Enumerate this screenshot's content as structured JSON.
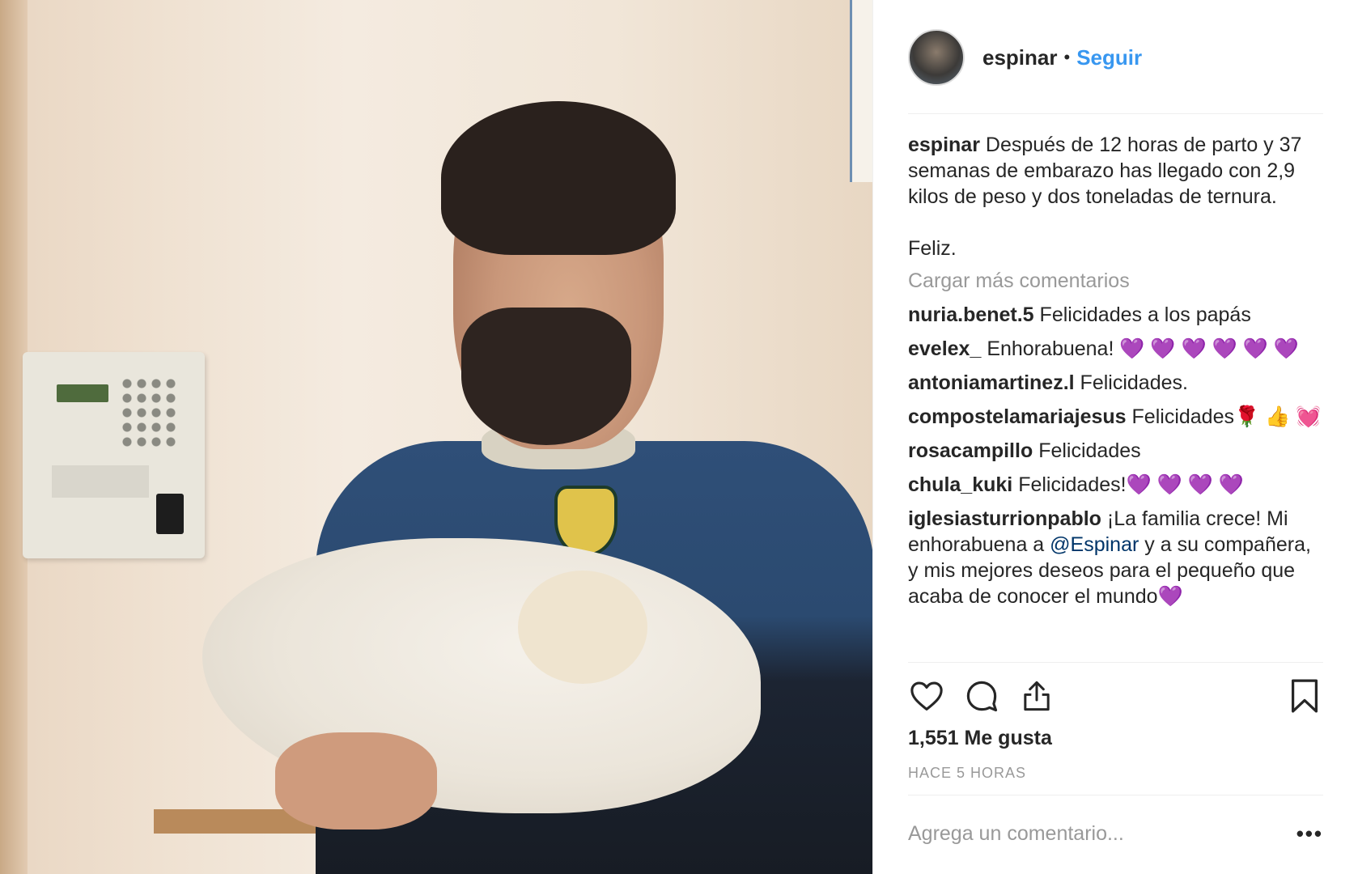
{
  "post": {
    "username": "espinar",
    "separator": "•",
    "follow_label": "Seguir",
    "caption": {
      "user": "espinar",
      "text": "Después de 12 horas de parto y 37 semanas de embarazo has llegado con 2,9 kilos de peso y dos toneladas de ternura.",
      "text2": "Feliz."
    },
    "load_more_label": "Cargar más comentarios",
    "comments": [
      {
        "user": "nuria.benet.5",
        "text": "Felicidades a los papás"
      },
      {
        "user": "evelex_",
        "text": "Enhorabuena! 💜 💜 💜 💜 💜 💜"
      },
      {
        "user": "antoniamartinez.l",
        "text": "Felicidades."
      },
      {
        "user": "compostelamariajesus",
        "text": "Felicidades🌹 👍 💓"
      },
      {
        "user": "rosacampillo",
        "text": "Felicidades"
      },
      {
        "user": "chula_kuki",
        "text": "Felicidades!💜 💜 💜 💜"
      },
      {
        "user": "iglesiasturrionpablo",
        "text_before": "¡La familia crece! Mi enhorabuena a ",
        "mention": "@Espinar",
        "text_after": " y a su compañera, y mis mejores deseos para el pequeño que acaba de conocer el mundo💜"
      }
    ],
    "likes_label": "1,551 Me gusta",
    "time_label": "HACE 5 HORAS",
    "comment_placeholder": "Agrega un comentario...",
    "more_label": "•••",
    "icons": {
      "like": "heart-icon",
      "comment": "comment-bubble-icon",
      "share": "share-upload-icon",
      "save": "bookmark-icon"
    },
    "colors": {
      "accent": "#3897f0",
      "mention": "#003569",
      "muted": "#999999",
      "text": "#262626"
    }
  }
}
